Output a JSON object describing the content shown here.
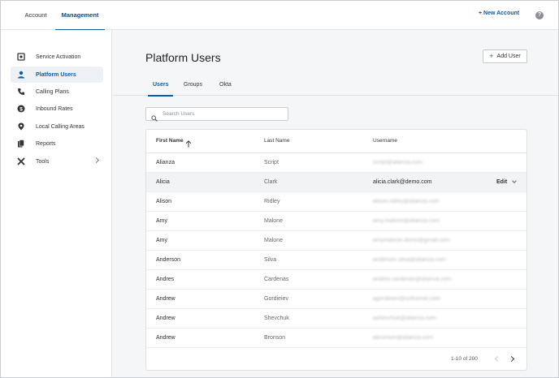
{
  "topbar": {
    "tabs": [
      {
        "label": "Account",
        "active": false
      },
      {
        "label": "Management",
        "active": true
      }
    ],
    "new_account_label": "+ New Account",
    "help_icon": "question-circle-icon"
  },
  "sidebar": {
    "items": [
      {
        "label": "Service Activation",
        "icon": "service-activation-icon",
        "active": false
      },
      {
        "label": "Platform Users",
        "icon": "user-icon",
        "active": true
      },
      {
        "label": "Calling Plans",
        "icon": "phone-icon",
        "active": false
      },
      {
        "label": "Inbound Rates",
        "icon": "dollar-icon",
        "active": false
      },
      {
        "label": "Local Calling Areas",
        "icon": "location-pin-icon",
        "active": false
      },
      {
        "label": "Reports",
        "icon": "reports-icon",
        "active": false
      },
      {
        "label": "Tools",
        "icon": "tools-icon",
        "active": false,
        "has_submenu": true
      }
    ]
  },
  "main": {
    "title": "Platform Users",
    "add_user_label": "Add User",
    "tabs": [
      {
        "label": "Users",
        "active": true
      },
      {
        "label": "Groups",
        "active": false
      },
      {
        "label": "Okta",
        "active": false
      }
    ],
    "search": {
      "placeholder": "Search Users",
      "value": ""
    },
    "table": {
      "columns": [
        "First Name",
        "Last Name",
        "Username"
      ],
      "sort_column": "First Name",
      "rows": [
        {
          "first": "Alianza",
          "last": "Script",
          "username": "script@alianza.com"
        },
        {
          "first": "Alicia",
          "last": "Clark",
          "username": "alicia.clark@demo.com",
          "hover": true,
          "action": "Edit"
        },
        {
          "first": "Alison",
          "last": "Ridley",
          "username": "alison.ridley@alianza.com"
        },
        {
          "first": "Amy",
          "last": "Malone",
          "username": "amy.malone@alianza.com"
        },
        {
          "first": "Amy",
          "last": "Malone",
          "username": "amymalone.demo@gmail.com"
        },
        {
          "first": "Anderson",
          "last": "Silva",
          "username": "anderson.silva@alianza.com"
        },
        {
          "first": "Andres",
          "last": "Cardenas",
          "username": "andres.cardenas@alianza.com"
        },
        {
          "first": "Andrew",
          "last": "Gordieiev",
          "username": "agordieiev@softserve.com"
        },
        {
          "first": "Andrew",
          "last": "Shevchuk",
          "username": "ashevchuk@alianza.com"
        },
        {
          "first": "Andrew",
          "last": "Bronson",
          "username": "abronson@alianza.com"
        }
      ]
    },
    "pagination": {
      "label": "1-10 of 200"
    }
  },
  "colors": {
    "accent": "#0a5ca8",
    "background": "#f4f6f8",
    "hover_row": "#f1f3f5"
  }
}
